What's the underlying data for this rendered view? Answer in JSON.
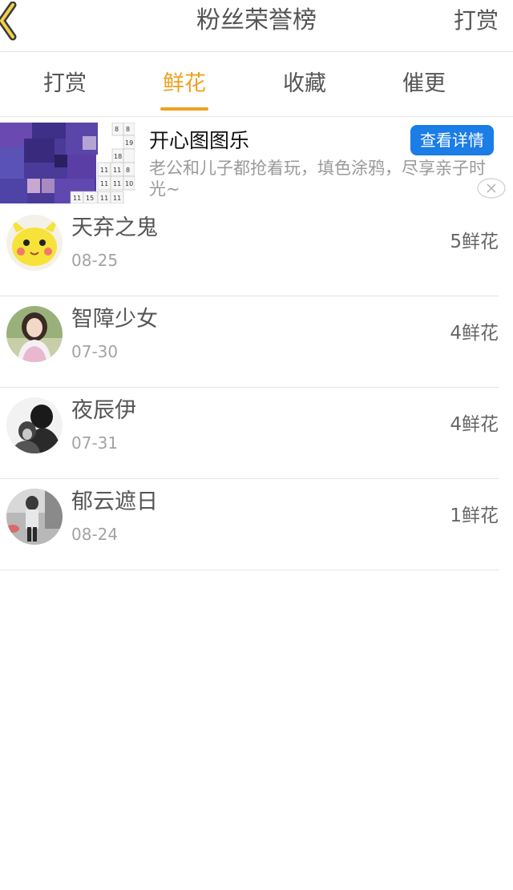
{
  "header": {
    "title": "粉丝荣誉榜",
    "right_action": "打赏"
  },
  "tabs": [
    {
      "label": "打赏",
      "active": false
    },
    {
      "label": "鲜花",
      "active": true
    },
    {
      "label": "收藏",
      "active": false
    },
    {
      "label": "催更",
      "active": false
    }
  ],
  "ad": {
    "title": "开心图图乐",
    "description": "老公和儿子都抢着玩，填色涂鸦，尽享亲子时光~",
    "button_label": "查看详情",
    "thumb_numbers": [
      "8",
      "8",
      "19",
      "18",
      "11",
      "11",
      "8",
      "11",
      "11",
      "10",
      "11",
      "15",
      "11",
      "11"
    ]
  },
  "fans": [
    {
      "name": "天弃之鬼",
      "date": "08-25",
      "count": "5鲜花",
      "avatar_icon": "pikachu-avatar"
    },
    {
      "name": "智障少女",
      "date": "07-30",
      "count": "4鲜花",
      "avatar_icon": "girl-avatar"
    },
    {
      "name": "夜辰伊",
      "date": "07-31",
      "count": "4鲜花",
      "avatar_icon": "bw-couple-avatar"
    },
    {
      "name": "郁云遮日",
      "date": "08-24",
      "count": "1鲜花",
      "avatar_icon": "street-avatar"
    }
  ],
  "colors": {
    "accent": "#f0a020",
    "button": "#1b7de6",
    "divider": "#e3e3e3"
  }
}
